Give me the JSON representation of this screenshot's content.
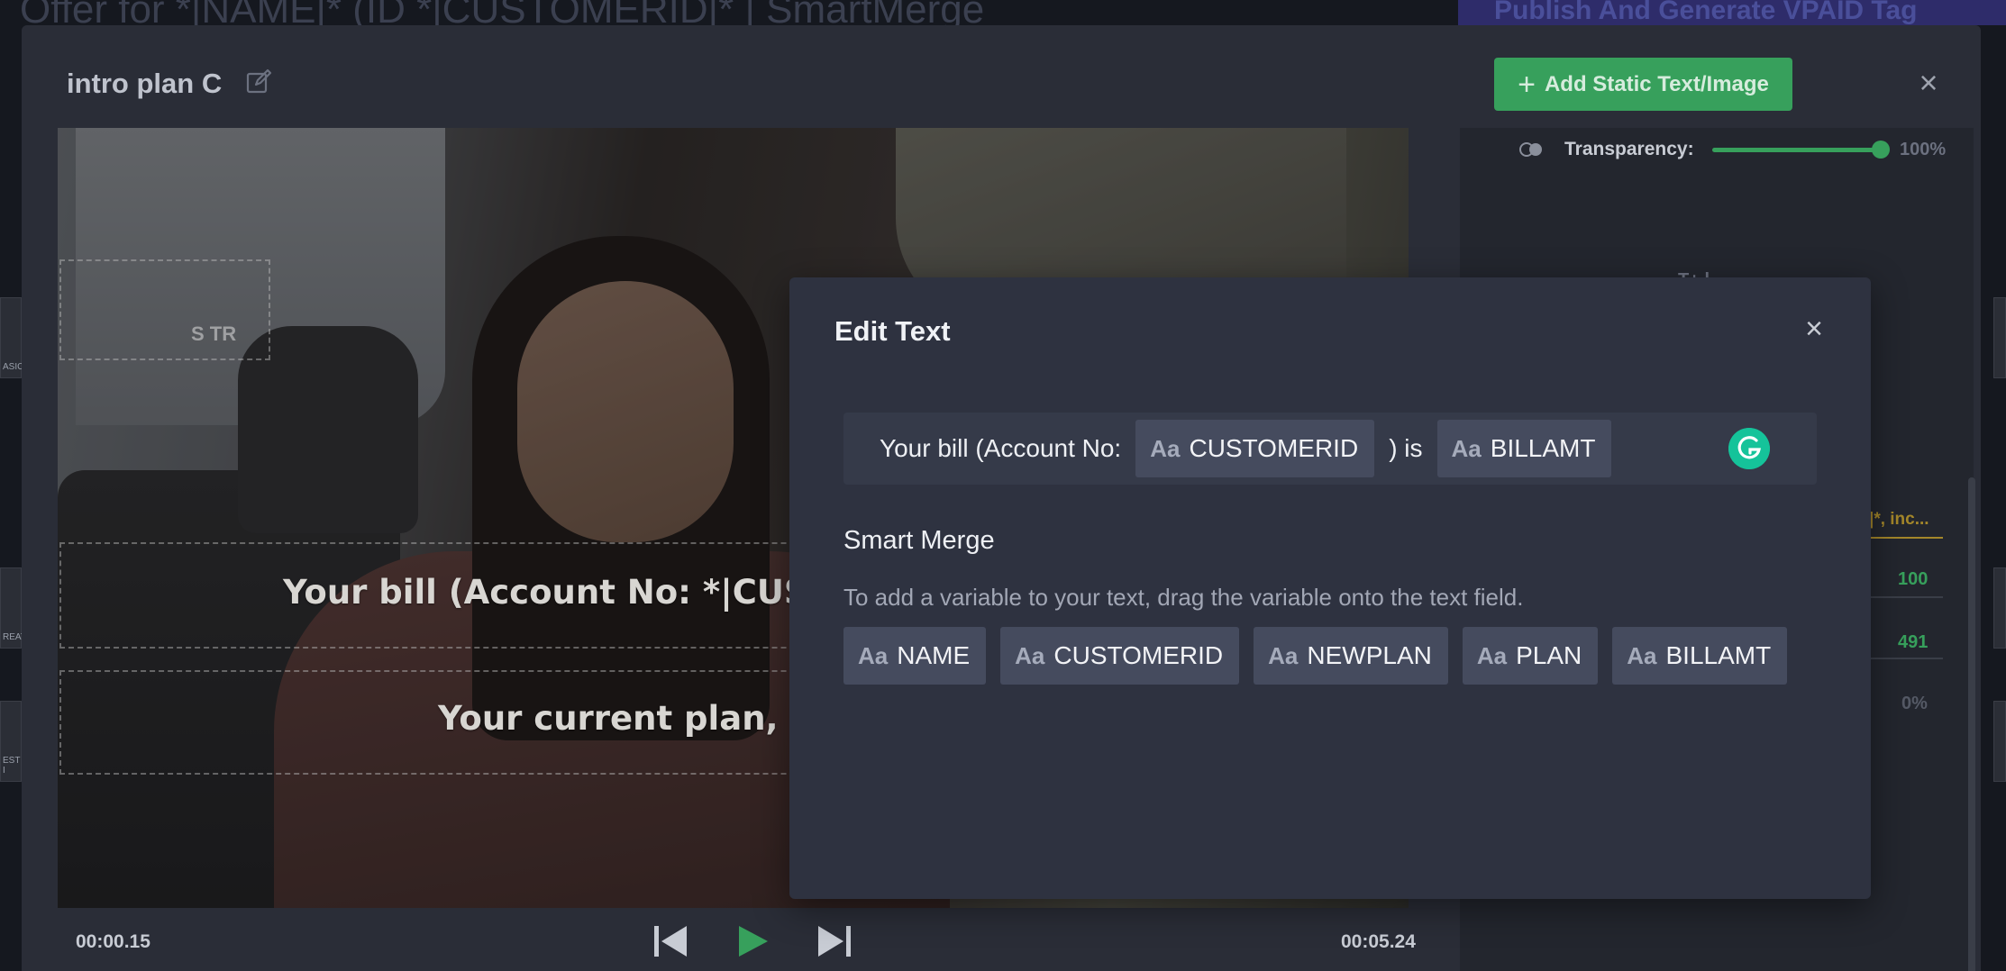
{
  "background": {
    "page_title": "Offer for *|NAME|* (ID *|CUSTOMERID|* | SmartMerge",
    "publish_button": "Publish And Generate VPAID Tag",
    "thumb_labels": [
      "ASIC",
      "REAT",
      "EST I"
    ]
  },
  "main_modal": {
    "title": "intro plan C",
    "add_static_label": "Add Static Text/Image",
    "close_icon": "×"
  },
  "video": {
    "overlay_label": "S TR",
    "text_line_1": "Your bill (Account No: *|CUSTOMERID|*) is *|BILLAMT|*",
    "text_line_2": "Your current plan, *|PLAN|*, includes",
    "time_current": "00:00.15",
    "time_total": "00:05.24"
  },
  "right_panel": {
    "transparency_label": "Transparency:",
    "transparency_value": "100%",
    "transparency_fraction": 1.0,
    "partial_text": "T+ l",
    "truncated_value": "|*, inc...",
    "value_1": "100",
    "value_2": "491",
    "value_3": "0%"
  },
  "edit_text_dialog": {
    "title": "Edit Text",
    "close_icon": "×",
    "text_field": {
      "segment_1": "Your bill (Account No:",
      "chip_1": "CUSTOMERID",
      "segment_2": ") is",
      "chip_2": "BILLAMT"
    },
    "chip_prefix": "Aa",
    "smart_merge_title": "Smart Merge",
    "smart_merge_desc": "To add a variable to your text, drag the variable onto the text field.",
    "variables": [
      "NAME",
      "CUSTOMERID",
      "NEWPLAN",
      "PLAN",
      "BILLAMT"
    ]
  },
  "colors": {
    "accent_green": "#37a05c",
    "grammarly_green": "#15c39a",
    "dialog_bg": "#2e3240",
    "chip_bg": "#454b5e"
  }
}
